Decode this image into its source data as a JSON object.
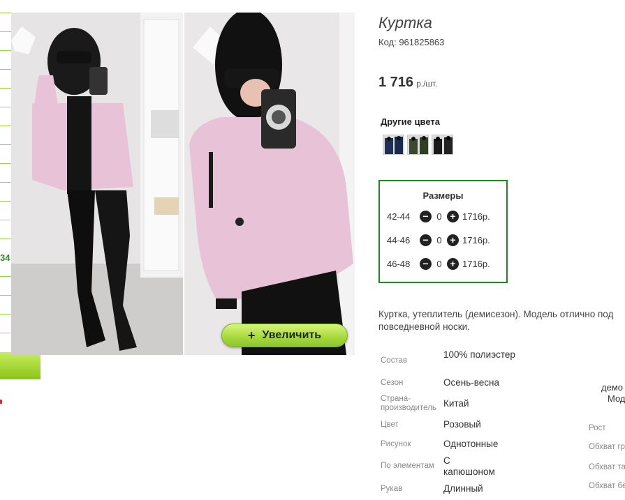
{
  "left": {
    "number": "34"
  },
  "photo": {
    "zoom_label": "Увеличить",
    "zoom_icon": "plus-icon"
  },
  "product": {
    "title": "Куртка",
    "code": "Код: 961825863",
    "price": "1 716",
    "price_unit": "р./шт."
  },
  "colors": {
    "title": "Другие цвета",
    "swatches": [
      "blue-jacket",
      "green-jacket",
      "black-jacket"
    ]
  },
  "sizes": {
    "title": "Размеры",
    "rows": [
      {
        "size": "42-44",
        "qty": "0",
        "price": "1716р."
      },
      {
        "size": "44-46",
        "qty": "0",
        "price": "1716р."
      },
      {
        "size": "46-48",
        "qty": "0",
        "price": "1716р."
      }
    ]
  },
  "description": {
    "line1": "Куртка, утеплитель (демисезон). Модель отлично под",
    "line2": "повседневной носки."
  },
  "properties": [
    {
      "key": "Состав",
      "value": "100% полиэстер"
    },
    {
      "key": "Сезон",
      "value": "Осень-весна"
    },
    {
      "key": "Страна-производитель",
      "value": "Китай"
    },
    {
      "key": "Цвет",
      "value": "Розовый"
    },
    {
      "key": "Рисунок",
      "value": "Однотонные"
    },
    {
      "key": "По элементам",
      "value": "С капюшоном"
    },
    {
      "key": "Рукав",
      "value": "Длинный"
    }
  ],
  "right_column": {
    "partial1": "демо",
    "partial2": "Мод",
    "keys": [
      "Рост",
      "Обхват гр",
      "Обхват та",
      "Обхват бё"
    ]
  },
  "colors_palette": {
    "accent_green": "#1e8a1e",
    "button_green": "#a5d93a",
    "jacket_pink": "#e8c2d6"
  }
}
